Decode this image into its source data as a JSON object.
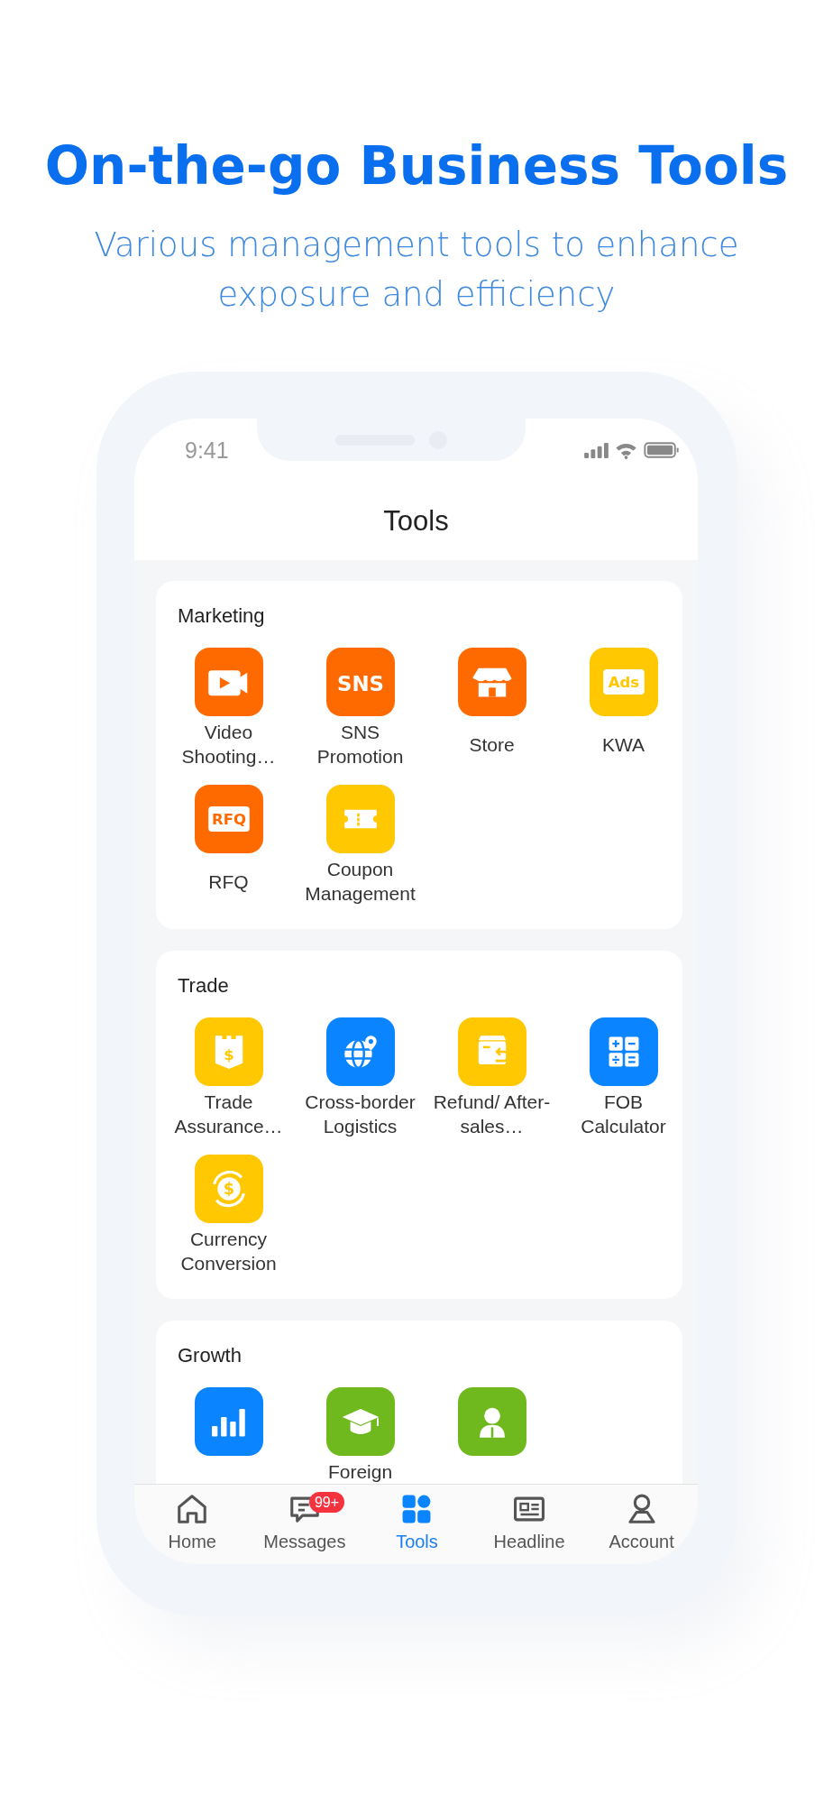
{
  "headline": "On-the-go Business Tools",
  "subtitle": "Various management tools to enhance exposure and efficiency",
  "status_bar": {
    "time": "9:41"
  },
  "header": {
    "title": "Tools"
  },
  "sections": [
    {
      "title": "Marketing",
      "tools": [
        {
          "label": "Video Shooting…",
          "kind": "video",
          "color": "#ff6a00"
        },
        {
          "label": "SNS Promotion",
          "kind": "text",
          "glyph": "SNS",
          "color": "#ff6a00"
        },
        {
          "label": "Store",
          "kind": "store",
          "color": "#ff6a00"
        },
        {
          "label": "KWA",
          "kind": "tag",
          "glyph": "Ads",
          "color": "#ffc800"
        },
        {
          "label": "RFQ",
          "kind": "tag",
          "glyph": "RFQ",
          "color": "#ff6a00"
        },
        {
          "label": "Coupon Management",
          "kind": "coupon",
          "color": "#ffc800"
        }
      ]
    },
    {
      "title": "Trade",
      "tools": [
        {
          "label": "Trade Assurance…",
          "kind": "shield",
          "glyph": "$",
          "color": "#ffc800"
        },
        {
          "label": "Cross-border Logistics",
          "kind": "globe",
          "color": "#0a84ff"
        },
        {
          "label": "Refund/ After-sales…",
          "kind": "box",
          "color": "#ffc800"
        },
        {
          "label": "FOB Calculator",
          "kind": "calculator",
          "color": "#0a84ff"
        },
        {
          "label": "Currency Conversion",
          "kind": "currency",
          "glyph": "$",
          "color": "#ffc800"
        }
      ]
    },
    {
      "title": "Growth",
      "tools": [
        {
          "kind": "chart",
          "color": "#0a84ff"
        },
        {
          "label": "Foreign",
          "kind": "cap",
          "color": "#6fb91f"
        },
        {
          "kind": "person",
          "color": "#6fb91f"
        }
      ]
    }
  ],
  "tab_bar": [
    {
      "label": "Home",
      "kind": "home",
      "selected": false
    },
    {
      "label": "Messages",
      "kind": "message",
      "badge": "99+",
      "selected": false
    },
    {
      "label": "Tools",
      "kind": "grid",
      "selected": true
    },
    {
      "label": "Headline",
      "kind": "news",
      "selected": false
    },
    {
      "label": "Account",
      "kind": "user",
      "selected": false
    }
  ]
}
